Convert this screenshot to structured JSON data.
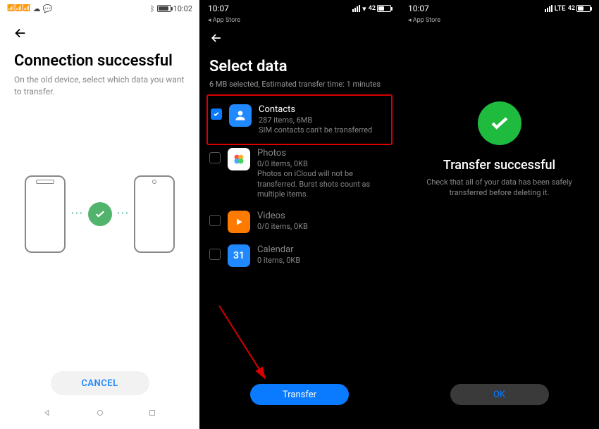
{
  "screen1": {
    "status": {
      "time": "10:02",
      "battery": "79"
    },
    "title": "Connection successful",
    "subtitle": "On the old device, select which data you want to transfer.",
    "cancel": "CANCEL"
  },
  "screen2": {
    "status": {
      "time": "10:07",
      "battery": "42"
    },
    "breadcrumb": "App Store",
    "title": "Select data",
    "subtitle": "6 MB selected,  Estimated transfer time: 1 minutes",
    "items": [
      {
        "title": "Contacts",
        "meta": "287 items, 6MB",
        "note": "SIM contacts can't be transferred",
        "checked": true
      },
      {
        "title": "Photos",
        "meta": "0/0 items, 0KB",
        "note": "Photos on iCloud will not be transferred. Burst shots count as multiple items.",
        "checked": false
      },
      {
        "title": "Videos",
        "meta": "0/0 items, 0KB",
        "note": "",
        "checked": false
      },
      {
        "title": "Calendar",
        "meta": "0 items, 0KB",
        "note": "",
        "checked": false
      }
    ],
    "calendar_day": "31",
    "transfer": "Transfer"
  },
  "screen3": {
    "status": {
      "time": "10:07",
      "battery": "42",
      "network": "LTE"
    },
    "breadcrumb": "App Store",
    "title": "Transfer successful",
    "subtitle": "Check that all of your data has been safely transferred before deleting it.",
    "ok": "OK"
  }
}
